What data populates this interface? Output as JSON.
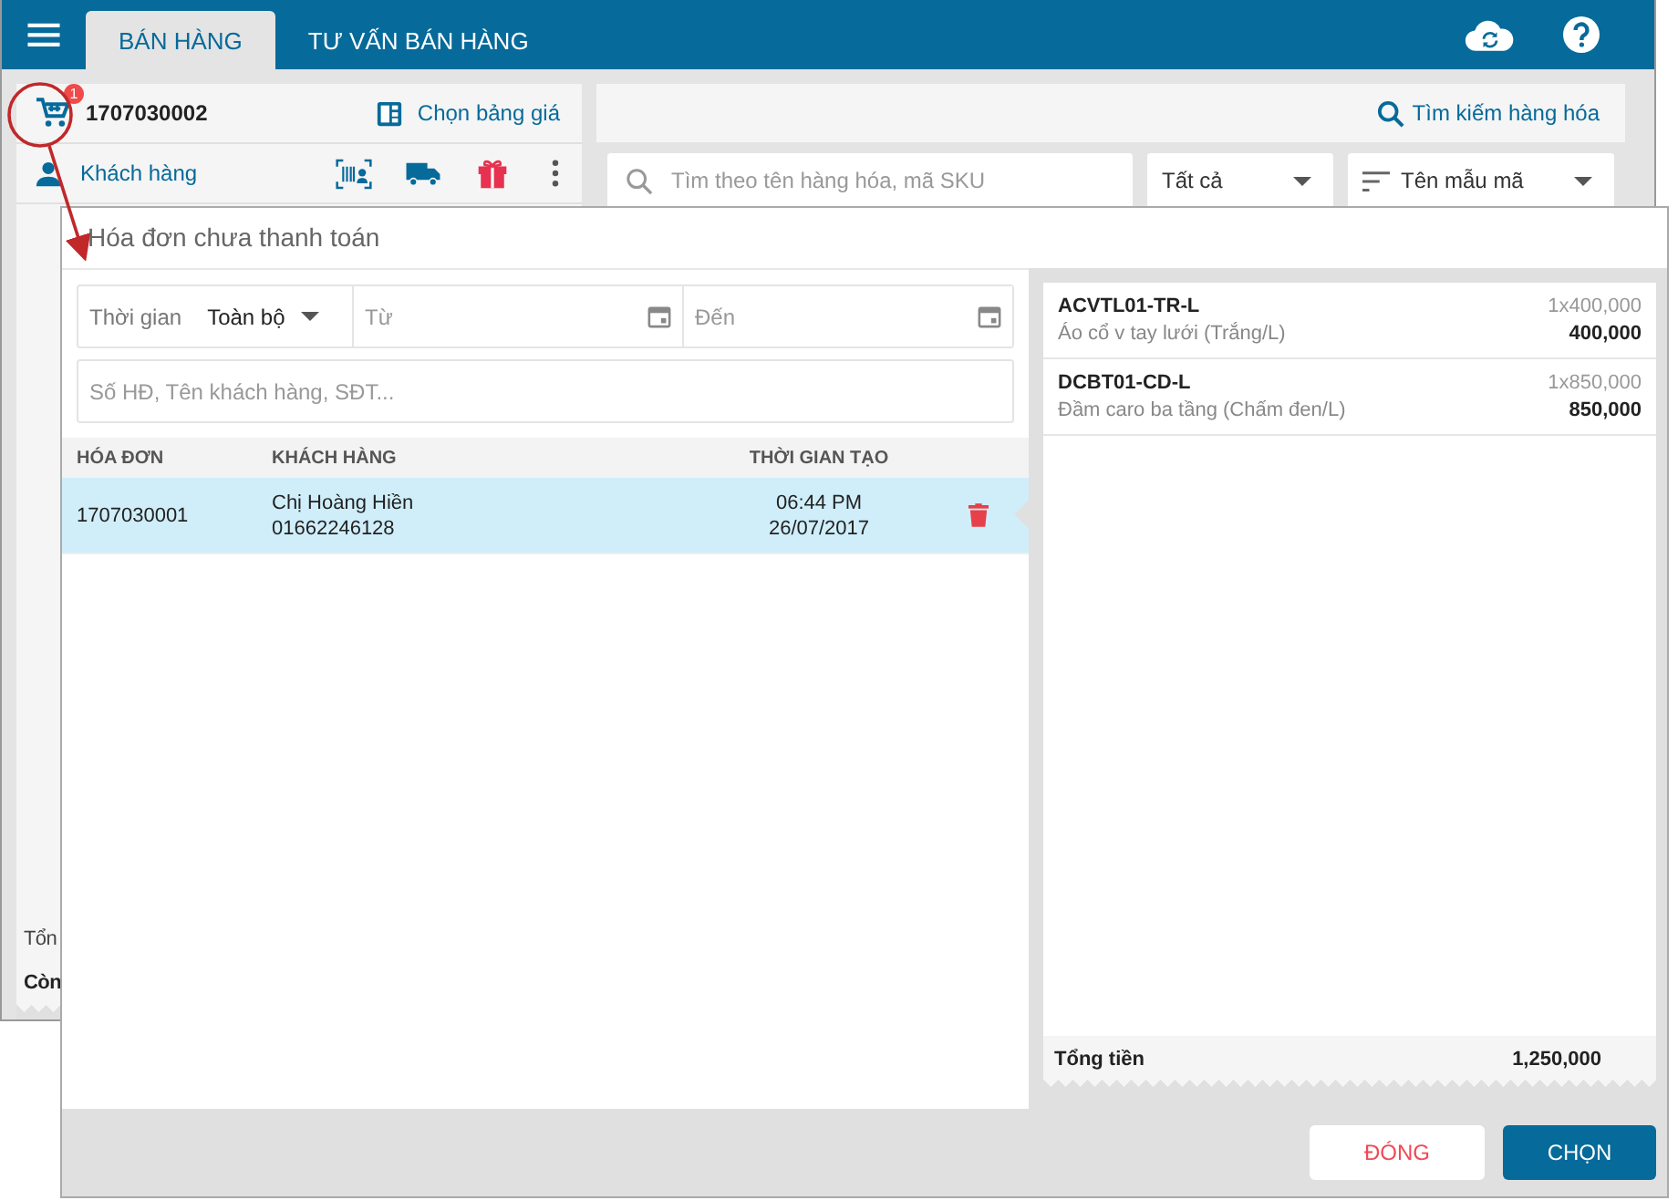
{
  "app": {
    "tabs": [
      {
        "label": "BÁN HÀNG",
        "selected": true
      },
      {
        "label": "TƯ VẤN BÁN HÀNG",
        "selected": false
      }
    ],
    "cart_badge": "1",
    "order_code": "1707030002",
    "price_list": "Chọn bảng giá",
    "customer": "Khách hàng",
    "search_link": "Tìm kiếm hàng hóa",
    "search": {
      "placeholder": "Tìm theo tên hàng hóa, mã SKU"
    },
    "category": "Tất cả",
    "sort": "Tên mẫu mã",
    "totals": [
      "Tổn",
      "Còn"
    ]
  },
  "dialog": {
    "title": "Hóa đơn chưa thanh toán",
    "time_label": "Thời gian",
    "time_value": "Toàn bộ",
    "from": {
      "placeholder": "Từ"
    },
    "to": {
      "placeholder": "Đến"
    },
    "search": {
      "placeholder": "Số HĐ, Tên khách hàng, SĐT..."
    },
    "table": {
      "columns": [
        "HÓA ĐƠN",
        "KHÁCH HÀNG",
        "THỜI GIAN TẠO"
      ],
      "rows": [
        {
          "invoice": "1707030001",
          "customer": "Chị Hoàng Hiền",
          "phone": "01662246128",
          "time": "06:44 PM",
          "date": "26/07/2017",
          "selected": true
        }
      ]
    },
    "items": [
      {
        "sku": "ACVTL01-TR-L",
        "name": "Áo cổ v tay lưới (Trắng/L)",
        "qty_price": "1x400,000",
        "amount": "400,000"
      },
      {
        "sku": "DCBT01-CD-L",
        "name": "Đầm caro ba tầng (Chấm đen/L)",
        "qty_price": "1x850,000",
        "amount": "850,000"
      }
    ],
    "total_label": "Tổng tiền",
    "total_value": "1,250,000",
    "buttons": [
      {
        "label": "ĐÓNG",
        "kind": "secondary"
      },
      {
        "label": "CHỌN",
        "kind": "primary"
      }
    ]
  }
}
